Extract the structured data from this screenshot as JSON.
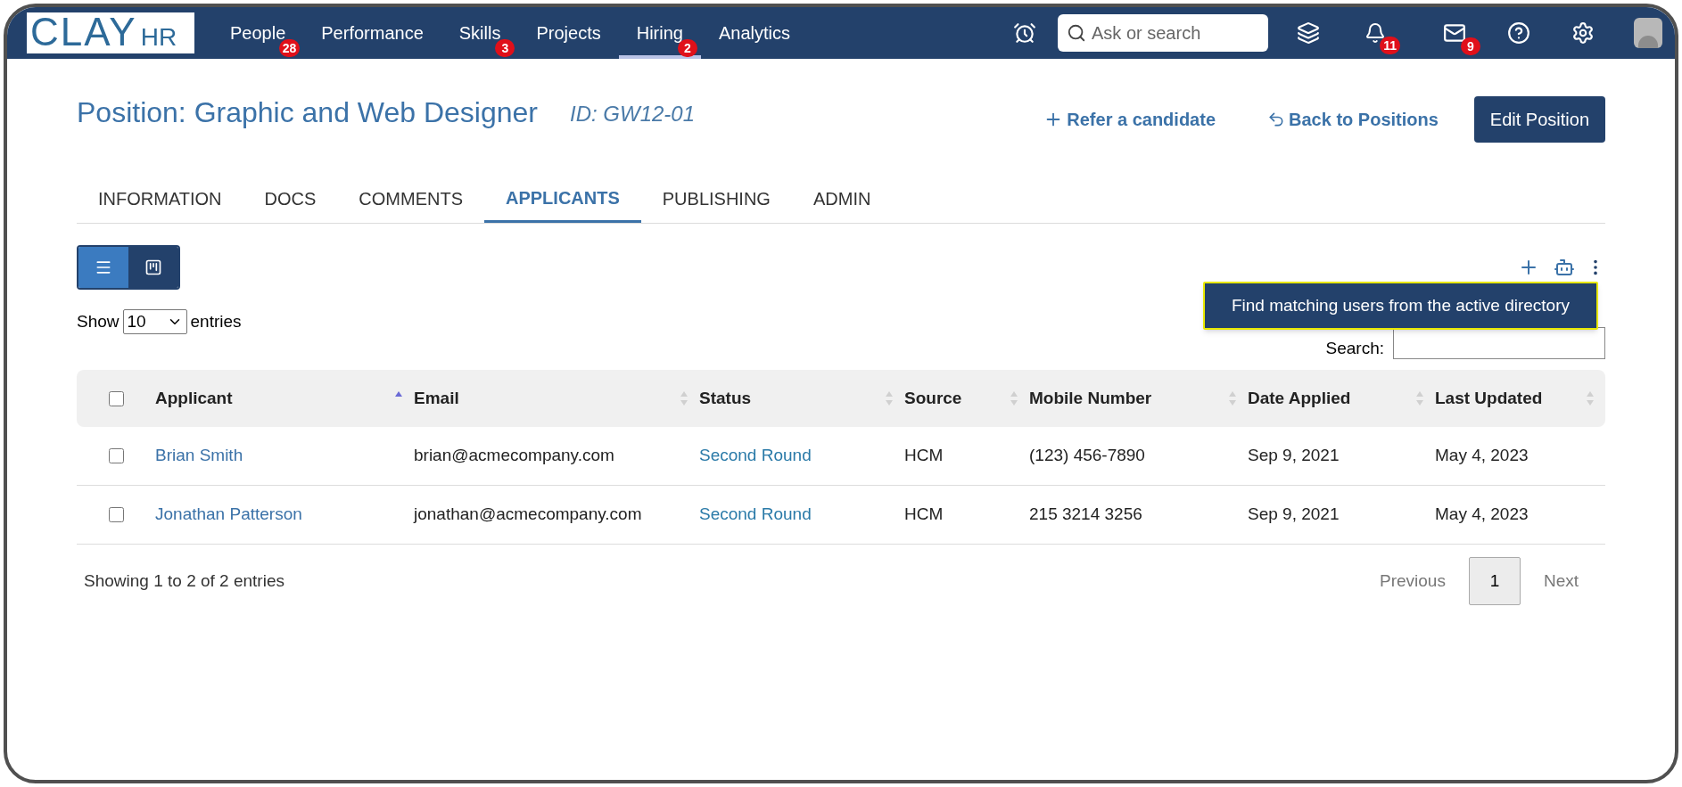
{
  "logo": {
    "main": "CLAY",
    "suffix": "HR"
  },
  "nav": [
    {
      "label": "People",
      "badge": "28",
      "selected": false
    },
    {
      "label": "Performance",
      "selected": false
    },
    {
      "label": "Skills",
      "badge": "3",
      "selected": false
    },
    {
      "label": "Projects",
      "selected": false
    },
    {
      "label": "Hiring",
      "badge": "2",
      "selected": true
    },
    {
      "label": "Analytics",
      "selected": false
    }
  ],
  "search": {
    "placeholder": "Ask or search"
  },
  "notifications": {
    "badge": "11"
  },
  "messages": {
    "badge": "9"
  },
  "title": "Position: Graphic and Web Designer",
  "position_id": "ID: GW12-01",
  "actions": {
    "refer": "Refer a candidate",
    "back": "Back to Positions",
    "edit": "Edit Position"
  },
  "tabs": [
    {
      "label": "INFORMATION",
      "selected": false
    },
    {
      "label": "DOCS",
      "selected": false
    },
    {
      "label": "COMMENTS",
      "selected": false
    },
    {
      "label": "APPLICANTS",
      "selected": true
    },
    {
      "label": "PUBLISHING",
      "selected": false
    },
    {
      "label": "ADMIN",
      "selected": false
    }
  ],
  "views": [
    {
      "kind": "list",
      "selected": true
    },
    {
      "kind": "board",
      "selected": false
    }
  ],
  "tooltip": "Find matching users from the active directory",
  "length": {
    "before": "Show",
    "value": "10",
    "after": "entries"
  },
  "table_search": {
    "label": "Search:"
  },
  "table": {
    "all_checked": false,
    "columns": [
      {
        "label": "Applicant",
        "sorted": true
      },
      {
        "label": "Email",
        "sorted": false
      },
      {
        "label": "Status",
        "sorted": false
      },
      {
        "label": "Source",
        "sorted": false
      },
      {
        "label": "Mobile Number",
        "sorted": false
      },
      {
        "label": "Date Applied",
        "sorted": false
      },
      {
        "label": "Last Updated",
        "sorted": false
      }
    ],
    "rows": [
      {
        "checked": false,
        "cells": [
          "Brian Smith",
          "brian@acmecompany.com",
          "Second Round",
          "HCM",
          "(123) 456-7890",
          "Sep 9, 2021",
          "May 4, 2023"
        ]
      },
      {
        "checked": false,
        "cells": [
          "Jonathan Patterson",
          "jonathan@acmecompany.com",
          "Second Round",
          "HCM",
          "215 3214 3256",
          "Sep 9, 2021",
          "May 4, 2023"
        ]
      }
    ]
  },
  "info": "Showing 1 to 2 of 2 entries",
  "pagination": {
    "previous": "Previous",
    "pages": [
      {
        "label": "1",
        "selected": true
      }
    ],
    "next": "Next"
  }
}
